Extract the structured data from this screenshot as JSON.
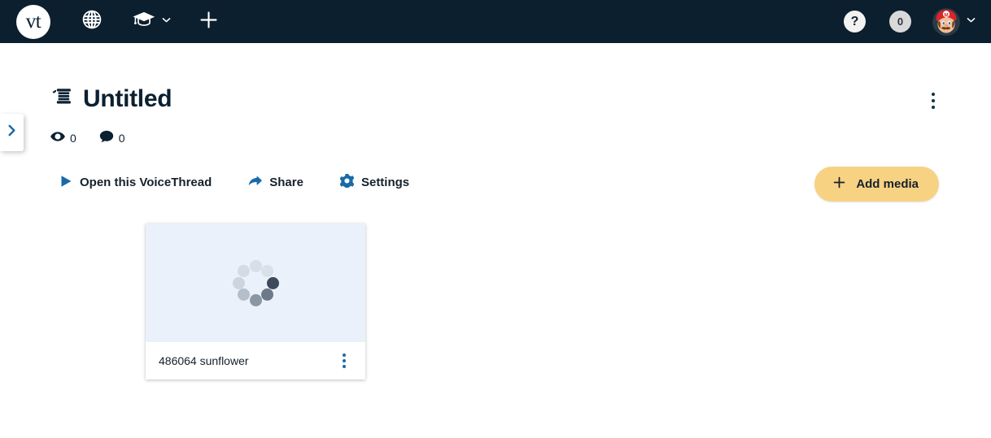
{
  "topnav": {
    "logo_text": "vt",
    "logo_name": "voicethread-logo",
    "globe_label": "globe-icon",
    "cap_label": "graduation-cap-icon",
    "plus_label": "plus-icon",
    "help_label": "?",
    "notification_count": "0",
    "avatar_label": "user-avatar",
    "background_color": "#0b1f2e"
  },
  "drawer": {
    "toggle_label": "expand-sidebar"
  },
  "header": {
    "title": "Untitled",
    "thread_icon": "spool-icon",
    "menu_label": "more-options"
  },
  "stats": {
    "views_icon": "eye-icon",
    "views": "0",
    "comments_icon": "comment-icon",
    "comments": "0"
  },
  "actions": [
    {
      "label": "Open this VoiceThread",
      "icon": "play-icon"
    },
    {
      "label": "Share",
      "icon": "share-icon"
    },
    {
      "label": "Settings",
      "icon": "gear-icon"
    }
  ],
  "add_media": {
    "label": "Add media",
    "icon": "plus-icon",
    "color": "#f8d283"
  },
  "media_items": [
    {
      "title": "486064 sunflower",
      "state": "loading",
      "spinner_icon": "loading-spinner",
      "menu_label": "media-options",
      "thumb_color": "#eaf1fa"
    }
  ],
  "accent_colors": {
    "link_blue": "#1a6aa8",
    "navy": "#0b2030",
    "amber": "#f8d283"
  }
}
